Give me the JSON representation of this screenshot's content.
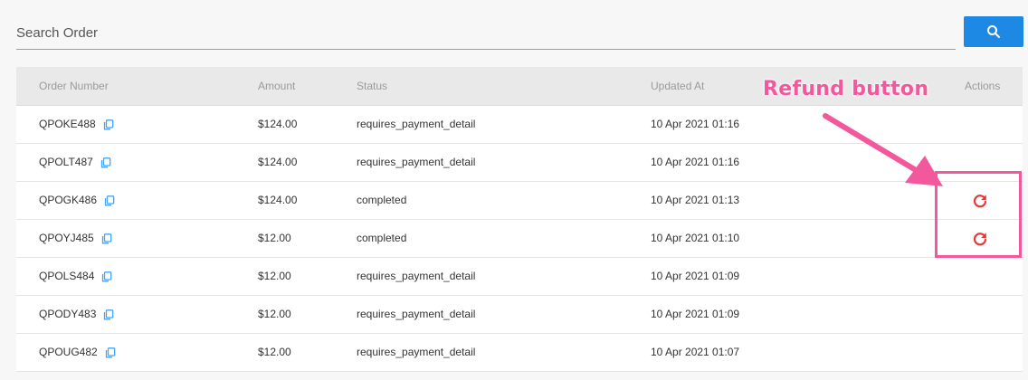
{
  "search": {
    "placeholder": "Search Order",
    "button_icon": "search-icon"
  },
  "table": {
    "headers": {
      "order_number": "Order Number",
      "amount": "Amount",
      "status": "Status",
      "updated_at": "Updated At",
      "actions": "Actions"
    },
    "rows": [
      {
        "order": "QPOKE488",
        "amount": "$124.00",
        "status": "requires_payment_detail",
        "updated": "10 Apr 2021 01:16",
        "refund": false
      },
      {
        "order": "QPOLT487",
        "amount": "$124.00",
        "status": "requires_payment_detail",
        "updated": "10 Apr 2021 01:16",
        "refund": false
      },
      {
        "order": "QPOGK486",
        "amount": "$124.00",
        "status": "completed",
        "updated": "10 Apr 2021 01:13",
        "refund": true
      },
      {
        "order": "QPOYJ485",
        "amount": "$12.00",
        "status": "completed",
        "updated": "10 Apr 2021 01:10",
        "refund": true
      },
      {
        "order": "QPOLS484",
        "amount": "$12.00",
        "status": "requires_payment_detail",
        "updated": "10 Apr 2021 01:09",
        "refund": false
      },
      {
        "order": "QPODY483",
        "amount": "$12.00",
        "status": "requires_payment_detail",
        "updated": "10 Apr 2021 01:09",
        "refund": false
      },
      {
        "order": "QPOUG482",
        "amount": "$12.00",
        "status": "requires_payment_detail",
        "updated": "10 Apr 2021 01:07",
        "refund": false
      }
    ]
  },
  "annotation": {
    "label": "Refund button"
  },
  "colors": {
    "accent": "#1e88e5",
    "refund": "#e53935",
    "annotation": "#f4589c",
    "copy": "#42a5f5"
  }
}
